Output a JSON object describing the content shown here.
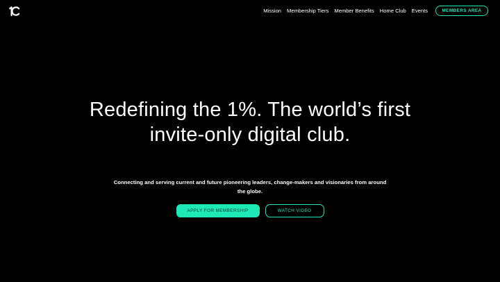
{
  "brand": {
    "logo_text": "1C",
    "accent_color": "#1ee8b6",
    "background_color": "#000000"
  },
  "nav": {
    "items": [
      "Mission",
      "Membership Tiers",
      "Member Benefits",
      "Home Club",
      "Events"
    ],
    "members_label": "MEMBERS AREA"
  },
  "hero": {
    "title": "Redefining the 1%. The world’s first invite-only digital club.",
    "subtitle": "Connecting and serving current and future pioneering leaders, change-makers and visionaries from around the globe.",
    "apply_label": "APPLY FOR MEMBERSHIP",
    "video_label": "WATCH VIDEO"
  }
}
